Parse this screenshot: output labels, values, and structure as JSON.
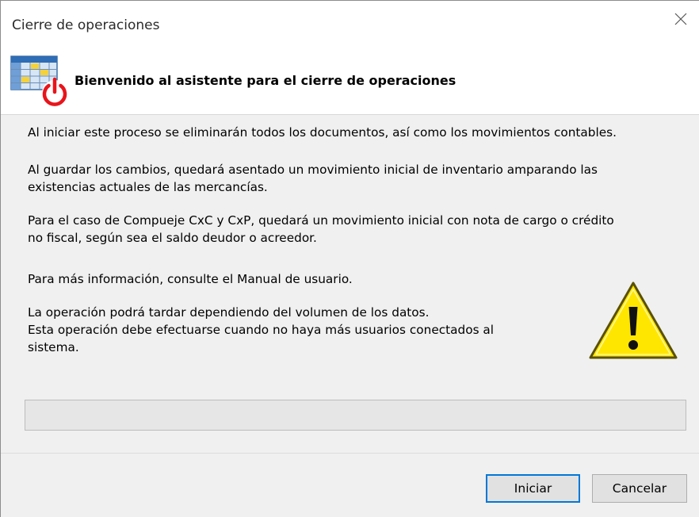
{
  "window": {
    "title": "Cierre de operaciones"
  },
  "header": {
    "title": "Bienvenido al asistente para el cierre de operaciones",
    "icon": "calendar-power-icon"
  },
  "messages": {
    "line1": "Al iniciar este proceso se eliminarán todos los documentos, así como los movimientos contables.",
    "line2a": "Al guardar los cambios, quedará asentado un movimiento inicial de inventario amparando las",
    "line2b": "existencias actuales de las mercancías.",
    "line3a": "Para el caso de Compueje CxC y CxP, quedará un movimiento inicial con nota de cargo o crédito",
    "line3b": "no fiscal, según sea el saldo deudor o acreedor.",
    "line4": "Para más información, consulte el Manual de usuario.",
    "line5a": "La operación podrá tardar dependiendo del volumen de los datos.",
    "line5b": "Esta operación debe efectuarse cuando no haya más usuarios conectados al",
    "line5c": "sistema."
  },
  "warning_icon": "warning-triangle-icon",
  "progress": {
    "value": 0
  },
  "buttons": {
    "start": "Iniciar",
    "cancel": "Cancelar"
  },
  "colors": {
    "accent": "#0078d7",
    "warning_fill": "#ffe600",
    "power_red": "#e8141b"
  }
}
